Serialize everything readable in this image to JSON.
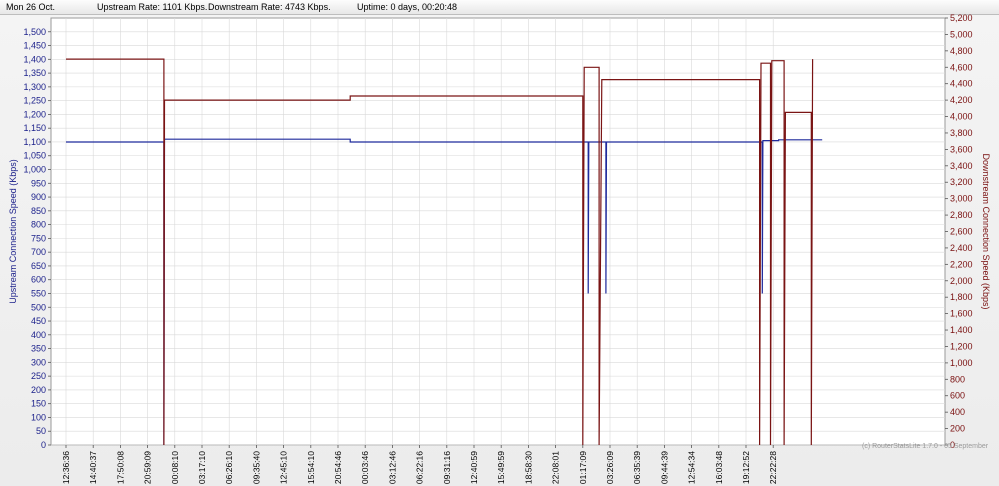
{
  "status": {
    "date": "Mon 26 Oct.",
    "upstream": "Upstream Rate: 1101 Kbps.",
    "downstream": "Downstream Rate: 4743 Kbps.",
    "uptime": "Uptime: 0 days, 00:20:48"
  },
  "watermark": "(c) RouterStatsLite 1.7.0 - 05 September",
  "colors": {
    "upstream": "#1f2a9c",
    "downstream": "#7a1414",
    "grid": "#d9d9d9"
  },
  "chart_data": {
    "type": "line",
    "xlabel": "",
    "ylabel": "Upstream Connection Speed (Kbps)",
    "ylabel_right": "Downstream Connection Speed (Kbps)",
    "ylim_left": [
      0,
      1550
    ],
    "ylim_right": [
      0,
      5200
    ],
    "x_tick_labels": [
      "12:36:36",
      "14:40:37",
      "17:50:08",
      "20:59:09",
      "00:08:10",
      "03:17:10",
      "06:26:10",
      "09:35:40",
      "12:45:10",
      "15:54:10",
      "20:54:46",
      "00:03:46",
      "03:12:46",
      "06:22:16",
      "09:31:16",
      "12:40:59",
      "15:49:59",
      "18:58:30",
      "22:08:01",
      "01:17:09",
      "03:26:09",
      "06:35:39",
      "09:44:39",
      "12:54:34",
      "16:03:48",
      "19:12:52",
      "22:22:28"
    ],
    "y_ticks_left": [
      "0",
      "50",
      "100",
      "150",
      "200",
      "250",
      "300",
      "350",
      "400",
      "450",
      "500",
      "550",
      "600",
      "650",
      "700",
      "750",
      "800",
      "850",
      "900",
      "950",
      "1,000",
      "1,050",
      "1,100",
      "1,150",
      "1,200",
      "1,250",
      "1,300",
      "1,350",
      "1,400",
      "1,450",
      "1,500"
    ],
    "y_ticks_right": [
      "0",
      "200",
      "400",
      "600",
      "800",
      "1,000",
      "1,200",
      "1,400",
      "1,600",
      "1,800",
      "2,000",
      "2,200",
      "2,400",
      "2,600",
      "2,800",
      "3,000",
      "3,200",
      "3,400",
      "3,600",
      "3,800",
      "4,000",
      "4,200",
      "4,400",
      "4,600",
      "4,800",
      "5,000",
      "5,200"
    ],
    "series": [
      {
        "name": "Upstream",
        "axis": "left",
        "points": [
          [
            0.0,
            1100
          ],
          [
            3.6,
            1100
          ],
          [
            3.6,
            0
          ],
          [
            3.62,
            1110
          ],
          [
            10.45,
            1110
          ],
          [
            10.45,
            1100
          ],
          [
            19.2,
            1100
          ],
          [
            19.2,
            550
          ],
          [
            19.22,
            1100
          ],
          [
            19.85,
            1100
          ],
          [
            19.85,
            550
          ],
          [
            19.87,
            1100
          ],
          [
            25.6,
            1100
          ],
          [
            25.6,
            550
          ],
          [
            25.62,
            1105
          ],
          [
            26.2,
            1105
          ],
          [
            26.2,
            1108
          ],
          [
            27.8,
            1108
          ]
        ]
      },
      {
        "name": "Downstream",
        "axis": "right",
        "points": [
          [
            0.0,
            4700
          ],
          [
            3.6,
            4700
          ],
          [
            3.6,
            0
          ],
          [
            3.62,
            4200
          ],
          [
            10.45,
            4200
          ],
          [
            10.45,
            4250
          ],
          [
            19.0,
            4250
          ],
          [
            19.0,
            0
          ],
          [
            19.05,
            4600
          ],
          [
            19.6,
            4600
          ],
          [
            19.6,
            0
          ],
          [
            19.7,
            4450
          ],
          [
            25.5,
            4450
          ],
          [
            25.5,
            0
          ],
          [
            25.55,
            4650
          ],
          [
            25.9,
            4650
          ],
          [
            25.9,
            0
          ],
          [
            25.95,
            4680
          ],
          [
            26.4,
            4680
          ],
          [
            26.4,
            0
          ],
          [
            26.45,
            4050
          ],
          [
            27.4,
            4050
          ],
          [
            27.4,
            0
          ],
          [
            27.45,
            4700
          ]
        ]
      }
    ],
    "grid": true,
    "legend": "none"
  }
}
